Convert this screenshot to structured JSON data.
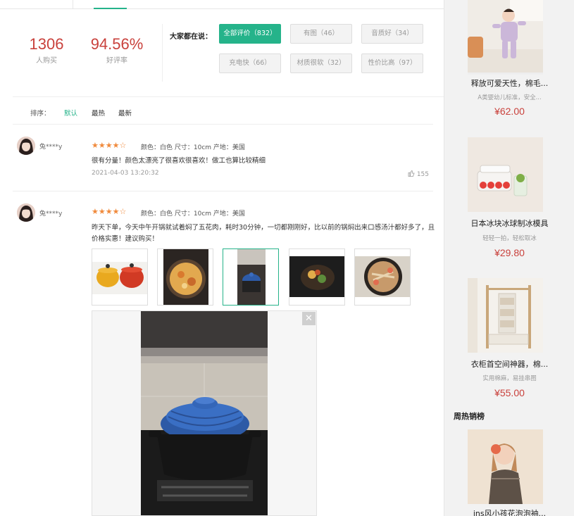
{
  "summary": {
    "buyers_count": "1306",
    "buyers_label": "人购买",
    "rating_rate": "94.56%",
    "rating_label": "好评率",
    "talk_label": "大家都在说：",
    "tags": [
      {
        "label": "全部评价（832）",
        "active": true
      },
      {
        "label": "有图（46）",
        "active": false
      },
      {
        "label": "音质好（34）",
        "active": false
      },
      {
        "label": "充电快（66）",
        "active": false
      },
      {
        "label": "材质很软（32）",
        "active": false
      },
      {
        "label": "性价比高（97）",
        "active": false
      }
    ]
  },
  "sort": {
    "label": "排序：",
    "options": [
      "默认",
      "最热",
      "最新"
    ],
    "selected": "默认"
  },
  "reviews": [
    {
      "user": "兔****y",
      "stars": 4,
      "stars_text": "★★★★☆",
      "attrs": "颜色：白色 尺寸：10cm 产地：美国",
      "content": "很有分量！颜色太漂亮了很喜欢很喜欢！做工也算比较精细",
      "date": "2021-04-03 13:20:32",
      "likes": "155"
    },
    {
      "user": "兔****y",
      "stars": 4,
      "stars_text": "★★★★☆",
      "attrs": "颜色：白色 尺寸：10cm 产地：美国",
      "content": "昨天下单，今天中午开锅就试着焖了五花肉，耗时30分钟，一切都刚刚好，比以前的锅焖出来口感汤汁都好多了，且价格实惠！建议购买！",
      "image_count": 5,
      "active_image": 3
    }
  ],
  "preview": {
    "close_glyph": "✕"
  },
  "sidebar": {
    "products": [
      {
        "title": "释放可爱天性，棉毛...",
        "subtitle": "A类婴幼儿标准，安全...",
        "price": "¥62.00"
      },
      {
        "title": "日本冰块冰球制冰模具",
        "subtitle": "轻轻一拍，轻松取冰",
        "price": "¥29.80"
      },
      {
        "title": "衣柜首空间神器，棉...",
        "subtitle": "实用棉麻，易挂串图",
        "price": "¥55.00"
      }
    ],
    "hot_title": "周热销榜",
    "hot_item_title": "ins风小孩花泡泡袖..."
  },
  "colors": {
    "accent": "#25b38a",
    "price": "#c9413c",
    "star": "#f08a3c"
  }
}
